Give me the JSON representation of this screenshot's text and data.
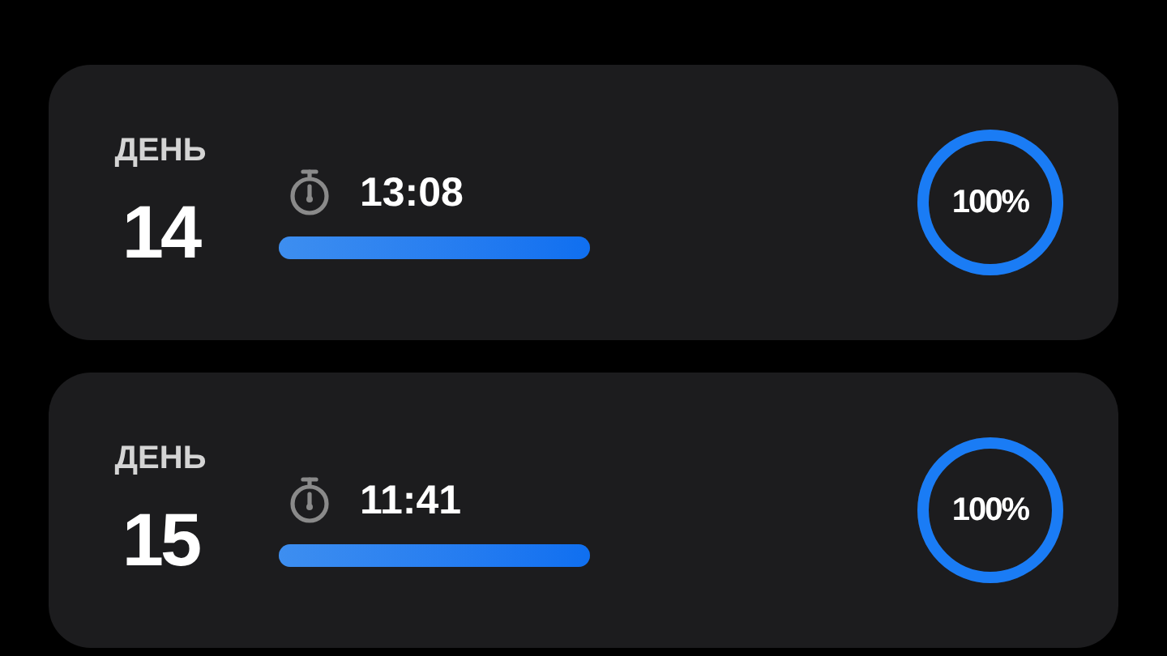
{
  "days": [
    {
      "label": "ДЕНЬ",
      "number": "14",
      "time": "13:08",
      "bar": {
        "level": 1
      },
      "ring": {
        "level": 1,
        "reading": "100%"
      }
    },
    {
      "label": "ДЕНЬ",
      "number": "15",
      "time": "11:41",
      "bar": {
        "level": 1
      },
      "ring": {
        "level": 1,
        "reading": "100%"
      }
    }
  ]
}
